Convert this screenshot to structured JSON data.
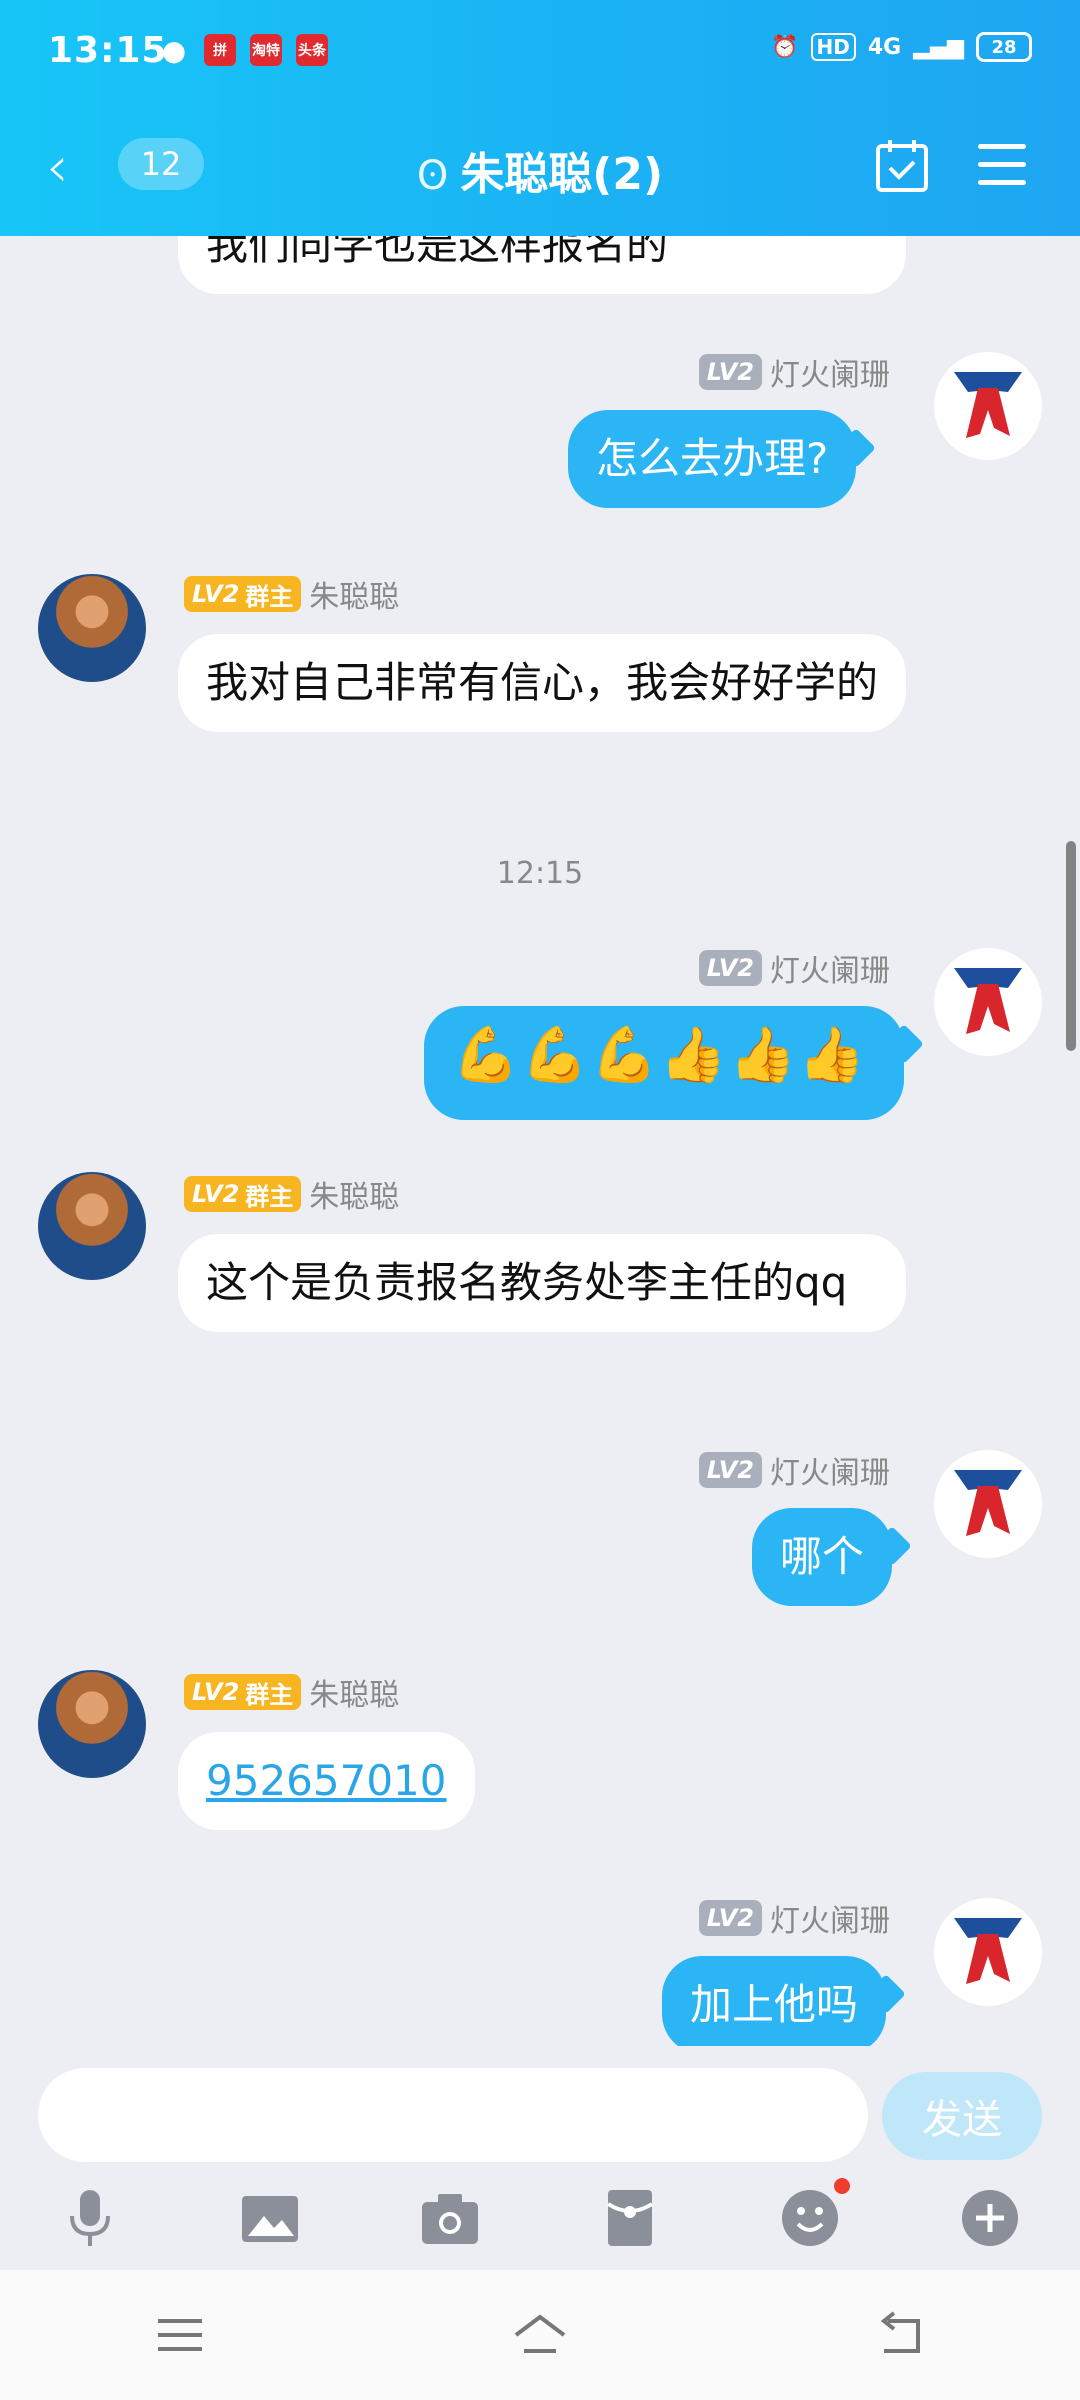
{
  "status_bar": {
    "time": "13:15",
    "app_icons": [
      "wechat-icon",
      "pinduoduo-icon",
      "taobao-icon",
      "toutiao-icon"
    ],
    "app_icon_labels": [
      "",
      "拼",
      "淘特",
      "头条"
    ],
    "hd": "HD",
    "network": "4G",
    "battery": "28"
  },
  "header": {
    "back_label": "‹",
    "unread_count": "12",
    "title": "朱聪聪(2)"
  },
  "messages": [
    {
      "side": "in",
      "text": "我们同学也是这样报名的"
    },
    {
      "side": "out",
      "sender": "灯火阑珊",
      "level": "LV2",
      "text": "怎么去办理?"
    },
    {
      "side": "in",
      "sender": "朱聪聪",
      "level": "LV2",
      "role": "群主",
      "text": "我对自己非常有信心，我会好好学的"
    },
    {
      "side": "out",
      "sender": "灯火阑珊",
      "level": "LV2",
      "text": "💪💪💪👍👍👍"
    },
    {
      "side": "in",
      "sender": "朱聪聪",
      "level": "LV2",
      "role": "群主",
      "text": "这个是负责报名教务处李主任的qq"
    },
    {
      "side": "out",
      "sender": "灯火阑珊",
      "level": "LV2",
      "text": "哪个"
    },
    {
      "side": "in",
      "sender": "朱聪聪",
      "level": "LV2",
      "role": "群主",
      "text": "952657010"
    },
    {
      "side": "out",
      "sender": "灯火阑珊",
      "level": "LV2",
      "text": "加上他吗"
    }
  ],
  "timestamp": "12:15",
  "input": {
    "placeholder": "",
    "value": "",
    "send_label": "发送"
  },
  "toolbar": [
    "mic-icon",
    "image-icon",
    "camera-icon",
    "red-packet-icon",
    "emoji-icon",
    "plus-icon"
  ],
  "colors": {
    "header": "#1bb2f4",
    "out_bubble": "#2bb5f5",
    "send_disabled": "#bfe7f9",
    "owner_badge": "#f7b522"
  }
}
